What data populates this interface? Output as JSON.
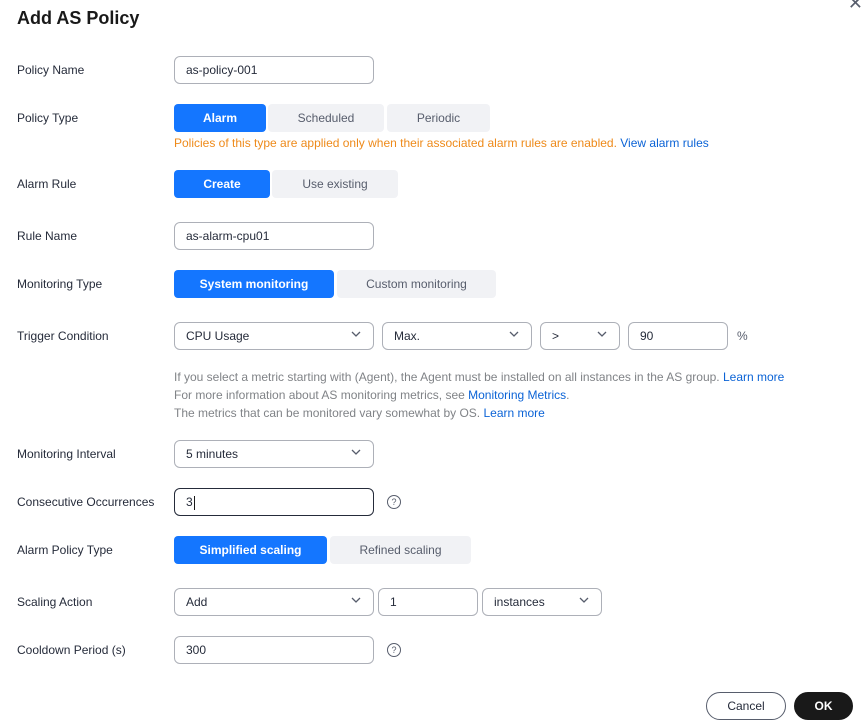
{
  "dialog": {
    "title": "Add AS Policy",
    "close_glyph": "✕",
    "close_icon": "close-icon"
  },
  "policy_name": {
    "label": "Policy Name",
    "value": "as-policy-001"
  },
  "policy_type": {
    "label": "Policy Type",
    "options": [
      "Alarm",
      "Scheduled",
      "Periodic"
    ],
    "selected": "Alarm",
    "hint": "Policies of this type are applied only when their associated alarm rules are enabled.",
    "hint_link": "View alarm rules"
  },
  "alarm_rule": {
    "label": "Alarm Rule",
    "options": [
      "Create",
      "Use existing"
    ],
    "selected": "Create"
  },
  "rule_name": {
    "label": "Rule Name",
    "value": "as-alarm-cpu01"
  },
  "monitoring_type": {
    "label": "Monitoring Type",
    "options": [
      "System monitoring",
      "Custom monitoring"
    ],
    "selected": "System monitoring"
  },
  "trigger_condition": {
    "label": "Trigger Condition",
    "metric": "CPU Usage",
    "aggregation": "Max.",
    "operator": ">",
    "threshold": "90",
    "unit": "%",
    "notes": {
      "line1": "If you select a metric starting with (Agent), the Agent must be installed on all instances in the AS group.",
      "line1_link": "Learn more",
      "line2": "For more information about AS monitoring metrics, see",
      "line2_link": "Monitoring Metrics",
      "line2_end": ".",
      "line3": "The metrics that can be monitored vary somewhat by OS.",
      "line3_link": "Learn more"
    }
  },
  "monitoring_interval": {
    "label": "Monitoring Interval",
    "value": "5 minutes"
  },
  "consecutive_occurrences": {
    "label": "Consecutive Occurrences",
    "value": "3",
    "help_glyph": "?"
  },
  "alarm_policy_type": {
    "label": "Alarm Policy Type",
    "options": [
      "Simplified scaling",
      "Refined scaling"
    ],
    "selected": "Simplified scaling"
  },
  "scaling_action": {
    "label": "Scaling Action",
    "action": "Add",
    "count": "1",
    "unit": "instances"
  },
  "cooldown": {
    "label": "Cooldown Period (s)",
    "value": "300",
    "help_glyph": "?"
  },
  "footer": {
    "cancel_label": "Cancel",
    "ok_label": "OK"
  },
  "colors": {
    "primary": "#1476ff",
    "warning": "#ee8a1a",
    "link": "#0b63d6",
    "ok_button": "#191919"
  }
}
